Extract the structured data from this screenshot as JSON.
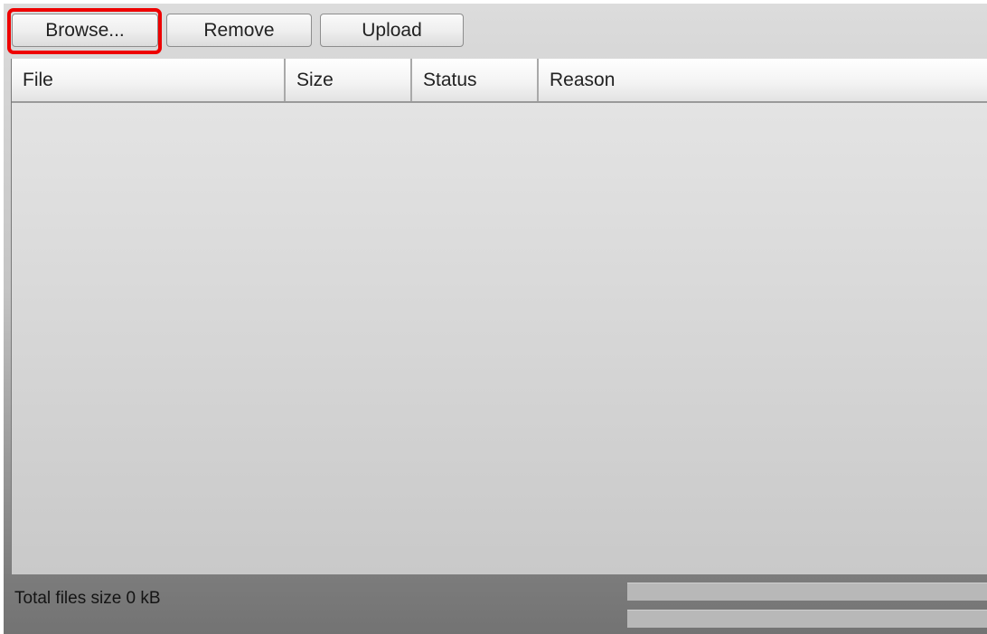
{
  "toolbar": {
    "browse_label": "Browse...",
    "remove_label": "Remove",
    "upload_label": "Upload"
  },
  "highlight": {
    "target": "browse-button",
    "color": "#ee0000"
  },
  "table": {
    "columns": [
      "File",
      "Size",
      "Status",
      "Reason"
    ],
    "rows": []
  },
  "footer": {
    "total_label": "Total files size 0 kB",
    "file_progress": 0,
    "total_progress": 0
  }
}
